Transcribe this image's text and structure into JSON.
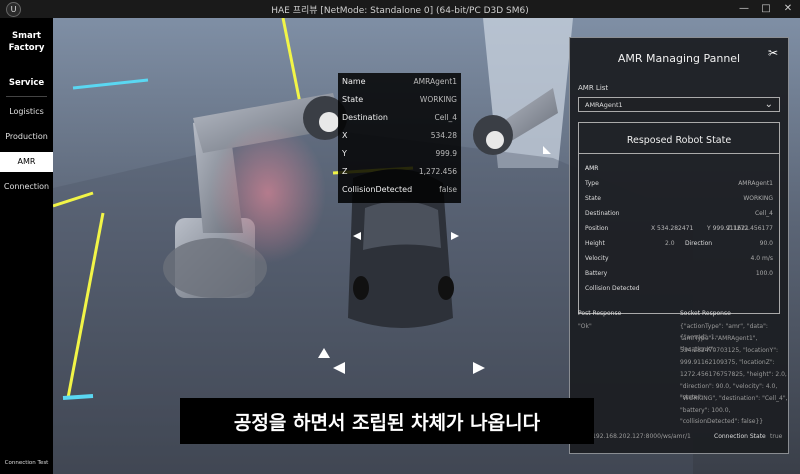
{
  "window": {
    "logo": "U",
    "title": "HAE 프리뷰 [NetMode: Standalone 0]  (64-bit/PC D3D SM6)",
    "controls": [
      "—",
      "□",
      "✕"
    ]
  },
  "sidebar": {
    "brand": "Smart\nFactory",
    "section": "Service",
    "items": [
      {
        "label": "Logistics"
      },
      {
        "label": "Production"
      },
      {
        "label": "AMR"
      },
      {
        "label": "Connection"
      }
    ],
    "footer": "Connection Test"
  },
  "agent_popup": {
    "rows": [
      {
        "key": "Name",
        "value": "AMRAgent1"
      },
      {
        "key": "State",
        "value": "WORKING"
      },
      {
        "key": "Destination",
        "value": "Cell_4"
      },
      {
        "key": "X",
        "value": "534.28"
      },
      {
        "key": "Y",
        "value": "999.9"
      },
      {
        "key": "Z",
        "value": "1,272.456"
      },
      {
        "key": "CollisionDetected",
        "value": "false"
      }
    ]
  },
  "panel": {
    "title": "AMR Managing Pannel",
    "amr_list_label": "AMR List",
    "amr_selected": "AMRAgent1",
    "state_title": "Resposed Robot State",
    "amr_label": "AMR",
    "type_label": "Type",
    "type_value": "AMRAgent1",
    "state_label": "State",
    "state_value": "WORKING",
    "dest_label": "Destination",
    "dest_value": "Cell_4",
    "position_label": "Position",
    "pos_x": "X 534.282471",
    "pos_y": "Y 999.911621",
    "pos_z": "Z 1272.456177",
    "height_label": "Height",
    "height_value": "2.0",
    "direction_label": "Direction",
    "direction_value": "90.0",
    "velocity_label": "Velocity",
    "velocity_value": "4.0 m/s",
    "battery_label": "Battery",
    "battery_value": "100.0",
    "collision_label": "Collision Detected",
    "post_label": "Post Response",
    "post_value": "\"Ok\"",
    "socket_label": "Socket Response",
    "socket_lines": [
      "{\"actionType\": \"amr\", \"data\": {\"amrId\": 1,",
      "\"amrType\": \"AMRAgent1\", \"locationX\":",
      "534.282470703125, \"locationY\":",
      "999.91162109375, \"locationZ\":",
      "1272.456176757825, \"height\": 2.0,",
      "\"direction\": 90.0, \"velocity\": 4.0, \"state\":",
      "\"WORKING\", \"destination\": \"Cell_4\",",
      "\"battery\": 100.0, \"collisionDetected\": false}}"
    ],
    "ws_url": "ws://192.168.202.127:8000/ws/amr/1",
    "conn_label": "Connection State",
    "conn_value": "true"
  },
  "caption": "공정을 하면서 조립된 차체가 나옵니다",
  "colors": {
    "accent": "#f2f547",
    "cyan": "#5ad7f2",
    "panel_bg": "#1c1e22"
  }
}
